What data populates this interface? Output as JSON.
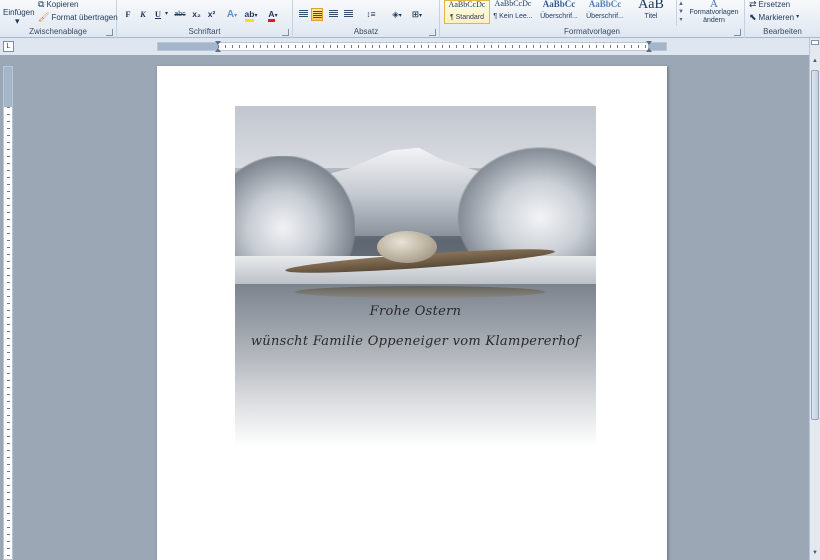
{
  "ribbon": {
    "clipboard": {
      "label": "Zwischenablage",
      "paste": "Einfügen",
      "copy": "Kopieren",
      "format_painter": "Format übertragen"
    },
    "font": {
      "label": "Schriftart",
      "bold": "F",
      "italic": "K",
      "underline": "U",
      "strike": "abc",
      "subscript": "x₂",
      "superscript": "x²"
    },
    "paragraph": {
      "label": "Absatz"
    },
    "styles": {
      "label": "Formatvorlagen",
      "items": [
        {
          "preview": "AaBbCcDc",
          "name": "¶ Standard"
        },
        {
          "preview": "AaBbCcDc",
          "name": "¶ Kein Lee..."
        },
        {
          "preview": "AaBbCc",
          "name": "Überschrif..."
        },
        {
          "preview": "AaBbCc",
          "name": "Überschrif..."
        },
        {
          "preview": "AaB",
          "name": "Titel"
        }
      ],
      "change_styles": "Formatvorlagen ändern"
    },
    "editing": {
      "label": "Bearbeiten",
      "replace": "Ersetzen",
      "select": "Markieren"
    }
  },
  "document": {
    "line1": "Frohe Ostern",
    "line2": "wünscht Familie Oppeneiger vom Klampererhof"
  },
  "colors": {
    "ribbon_bg": "#dfe7f1",
    "workspace": "#9ba7b5",
    "active_button": "#f8c861"
  }
}
